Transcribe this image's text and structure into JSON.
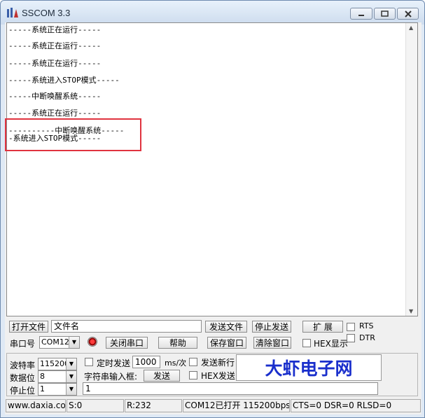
{
  "window": {
    "title": "SSCOM 3.3"
  },
  "receive_area": {
    "lines": [
      "-----系统正在运行-----",
      "-----系统正在运行-----",
      "-----系统正在运行-----",
      "-----系统进入STOP模式-----",
      "-----中断唤醒系统-----",
      "-----系统正在运行-----",
      "----------中断唤醒系统-----",
      "-系统进入STOP模式-----"
    ]
  },
  "toolbar": {
    "open_file": "打开文件",
    "file_name": "文件名",
    "send_file": "发送文件",
    "stop_send": "停止发送",
    "expand": "扩 展",
    "rts": "RTS",
    "dtr": "DTR",
    "port_label": "串口号",
    "port_value": "COM12",
    "close_port": "关闭串口",
    "help": "帮助",
    "save_window": "保存窗口",
    "clear_window": "清除窗口",
    "hex_display": "HEX显示"
  },
  "settings": {
    "baud_label": "波特率",
    "baud_value": "115200",
    "databits_label": "数据位",
    "databits_value": "8",
    "stopbits_label": "停止位",
    "stopbits_value": "1",
    "timed_send": "定时发送",
    "interval_value": "1000",
    "interval_unit": "ms/次",
    "send_newline": "发送新行",
    "input_label": "字符串输入框:",
    "send_button": "发送",
    "hex_send": "HEX发送",
    "input_value": "1",
    "brand": "大虾电子网"
  },
  "statusbar": {
    "website": "www.daxia.com",
    "sent": "S:0",
    "received": "R:232",
    "port_status": "COM12已打开  115200bps",
    "signals": "CTS=0 DSR=0 RLSD=0"
  }
}
